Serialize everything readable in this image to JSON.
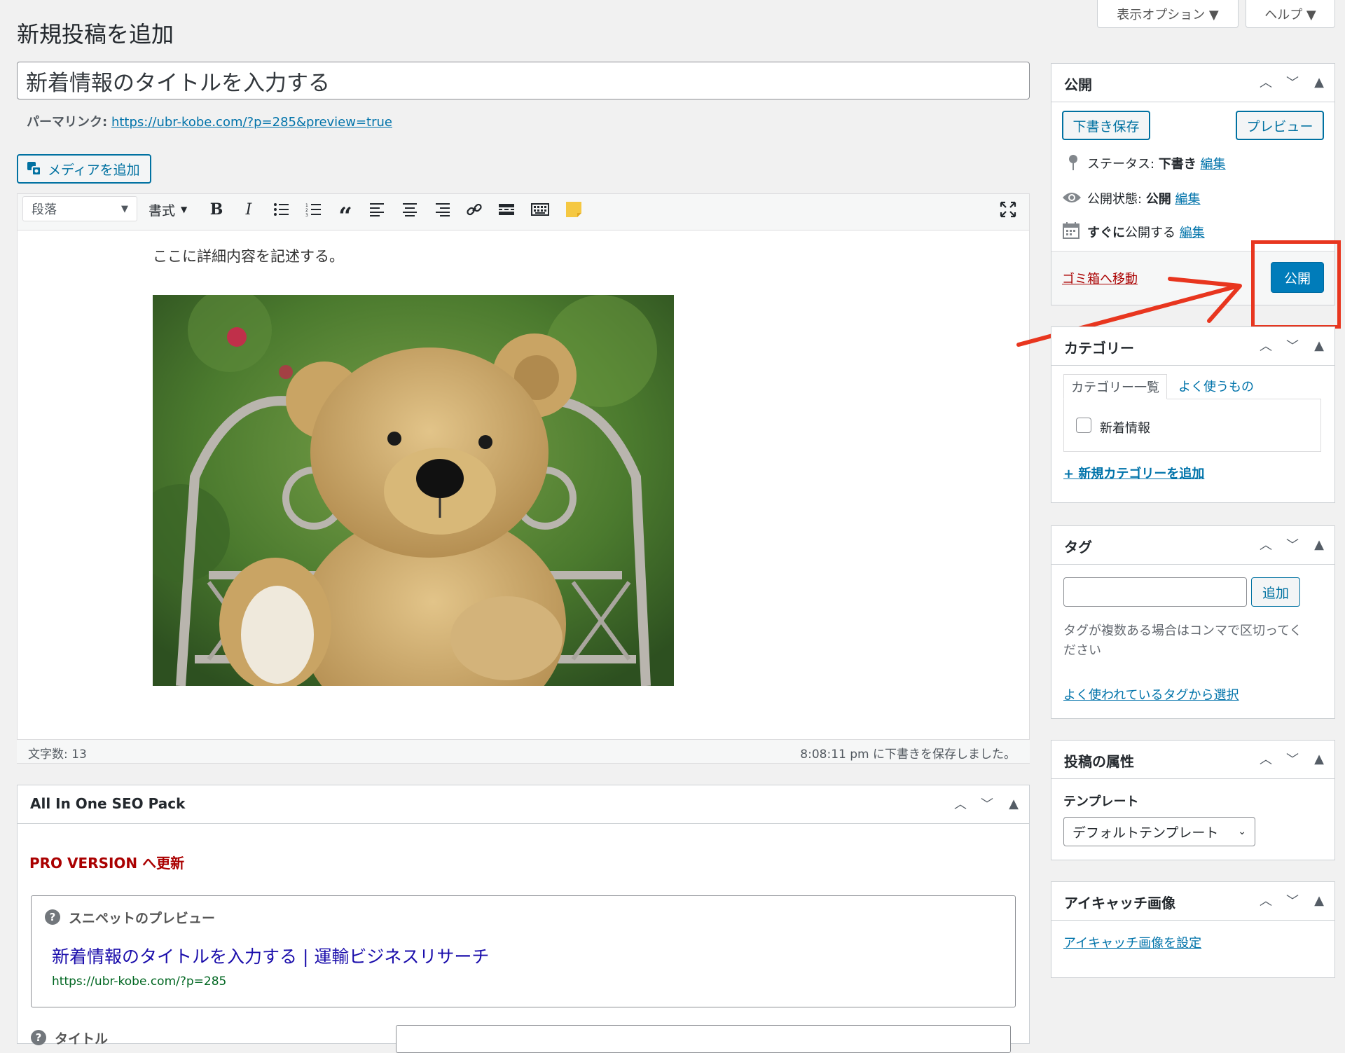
{
  "page": {
    "heading": "新規投稿を追加",
    "screen_options": "表示オプション ▼",
    "help": "ヘルプ ▼"
  },
  "editor": {
    "title_value": "新着情報のタイトルを入力する",
    "permalink_label": "パーマリンク:",
    "permalink_url": "https://ubr-kobe.com/?p=285&preview=true",
    "add_media": "メディアを追加",
    "format_select": "段落",
    "format_menu": "書式",
    "body_text": "ここに詳細内容を記述する。",
    "word_count": "文字数: 13",
    "save_status": "8:08:11 pm に下書きを保存しました。"
  },
  "seo": {
    "title": "All In One SEO Pack",
    "upgrade": "PRO VERSION へ更新",
    "snippet_label": "スニペットのプレビュー",
    "snippet_title": "新着情報のタイトルを入力する | 運輸ビジネスリサーチ",
    "snippet_url": "https://ubr-kobe.com/?p=285",
    "next_label": "タイトル"
  },
  "publish": {
    "title": "公開",
    "save_draft": "下書き保存",
    "preview": "プレビュー",
    "status_label": "ステータス:",
    "status_value": "下書き",
    "visibility_label": "公開状態:",
    "visibility_value": "公開",
    "schedule_bold": "すぐに",
    "schedule_rest": "公開する",
    "edit": "編集",
    "trash": "ゴミ箱へ移動",
    "publish_button": "公開"
  },
  "category": {
    "title": "カテゴリー",
    "tab_all": "カテゴリー一覧",
    "tab_popular": "よく使うもの",
    "items": [
      "新着情報"
    ],
    "add_new": "+ 新規カテゴリーを追加"
  },
  "tags": {
    "title": "タグ",
    "add": "追加",
    "hint_line1": "タグが複数ある場合はコンマで区切ってく",
    "hint_line2": "ださい",
    "choose": "よく使われているタグから選択"
  },
  "attributes": {
    "title": "投稿の属性",
    "template_label": "テンプレート",
    "template_value": "デフォルトテンプレート"
  },
  "featured": {
    "title": "アイキャッチ画像",
    "set": "アイキャッチ画像を設定"
  },
  "colors": {
    "accent": "#0073aa",
    "publish_bg": "#007cba",
    "trash": "#a00",
    "annotation": "#e8361f",
    "url_green": "#006621"
  }
}
